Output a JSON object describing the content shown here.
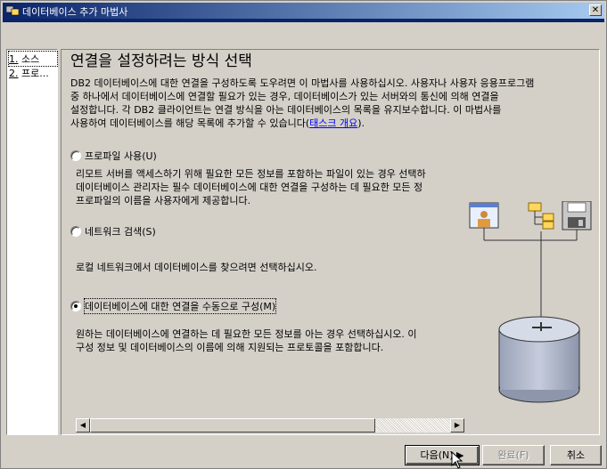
{
  "window": {
    "title": "데이터베이스 추가 마법사",
    "close_label": "✕"
  },
  "nav": {
    "items": [
      {
        "num": "1.",
        "label": "소스"
      },
      {
        "num": "2.",
        "label": "프로..."
      }
    ]
  },
  "main": {
    "heading": "연결을 설정하려는 방식 선택",
    "description_lines": [
      "DB2 데이터베이스에 대한 연결을 구성하도록 도우려면 이 마법사를 사용하십시오. 사용자나 사용자 응용프로그램",
      "중 하나에서 데이터베이스에 연결할 필요가 있는 경우, 데이터베이스가 있는 서버와의 통신에 의해 연결을",
      "설정합니다. 각 DB2 클라이언트는 연결 방식을 아는 데이터베이스의 목록을 유지보수합니다. 이 마법사를",
      "사용하여 데이터베이스를 해당 목록에 추가할 수 있습니다("
    ],
    "description_link": "태스크 개요",
    "description_end": ").",
    "options": [
      {
        "label": "프로파일 사용(U)",
        "lines": [
          "리모트 서버를 액세스하기 위해 필요한 모든 정보를 포함하는 파일이 있는 경우 선택하",
          "데이터베이스 관리자는 필수 데이터베이스에 대한 연결을 구성하는 데 필요한 모든 정",
          "프로파일의 이름을 사용자에게 제공합니다."
        ]
      },
      {
        "label": "네트워크 검색(S)",
        "lines": [
          "로컬 네트워크에서 데이터베이스를 찾으려면 선택하십시오."
        ]
      },
      {
        "label": "데이터베이스에 대한 연결을 수동으로 구성(M)",
        "lines": [
          "원하는 데이터베이스에 연결하는 데 필요한 모든 정보를 아는 경우 선택하십시오. 이",
          "구성 정보 및 데이터베이스의 이름에 의해 지원되는 프로토콜을 포함합니다."
        ]
      }
    ],
    "selected_option": 2
  },
  "footer": {
    "next_label": "다음(N)",
    "finish_label": "완료(F)",
    "cancel_label": "취소"
  },
  "colors": {
    "title_start": "#0a246a",
    "title_end": "#a6caf0",
    "face": "#d4d0c8",
    "link": "#0000ff"
  }
}
